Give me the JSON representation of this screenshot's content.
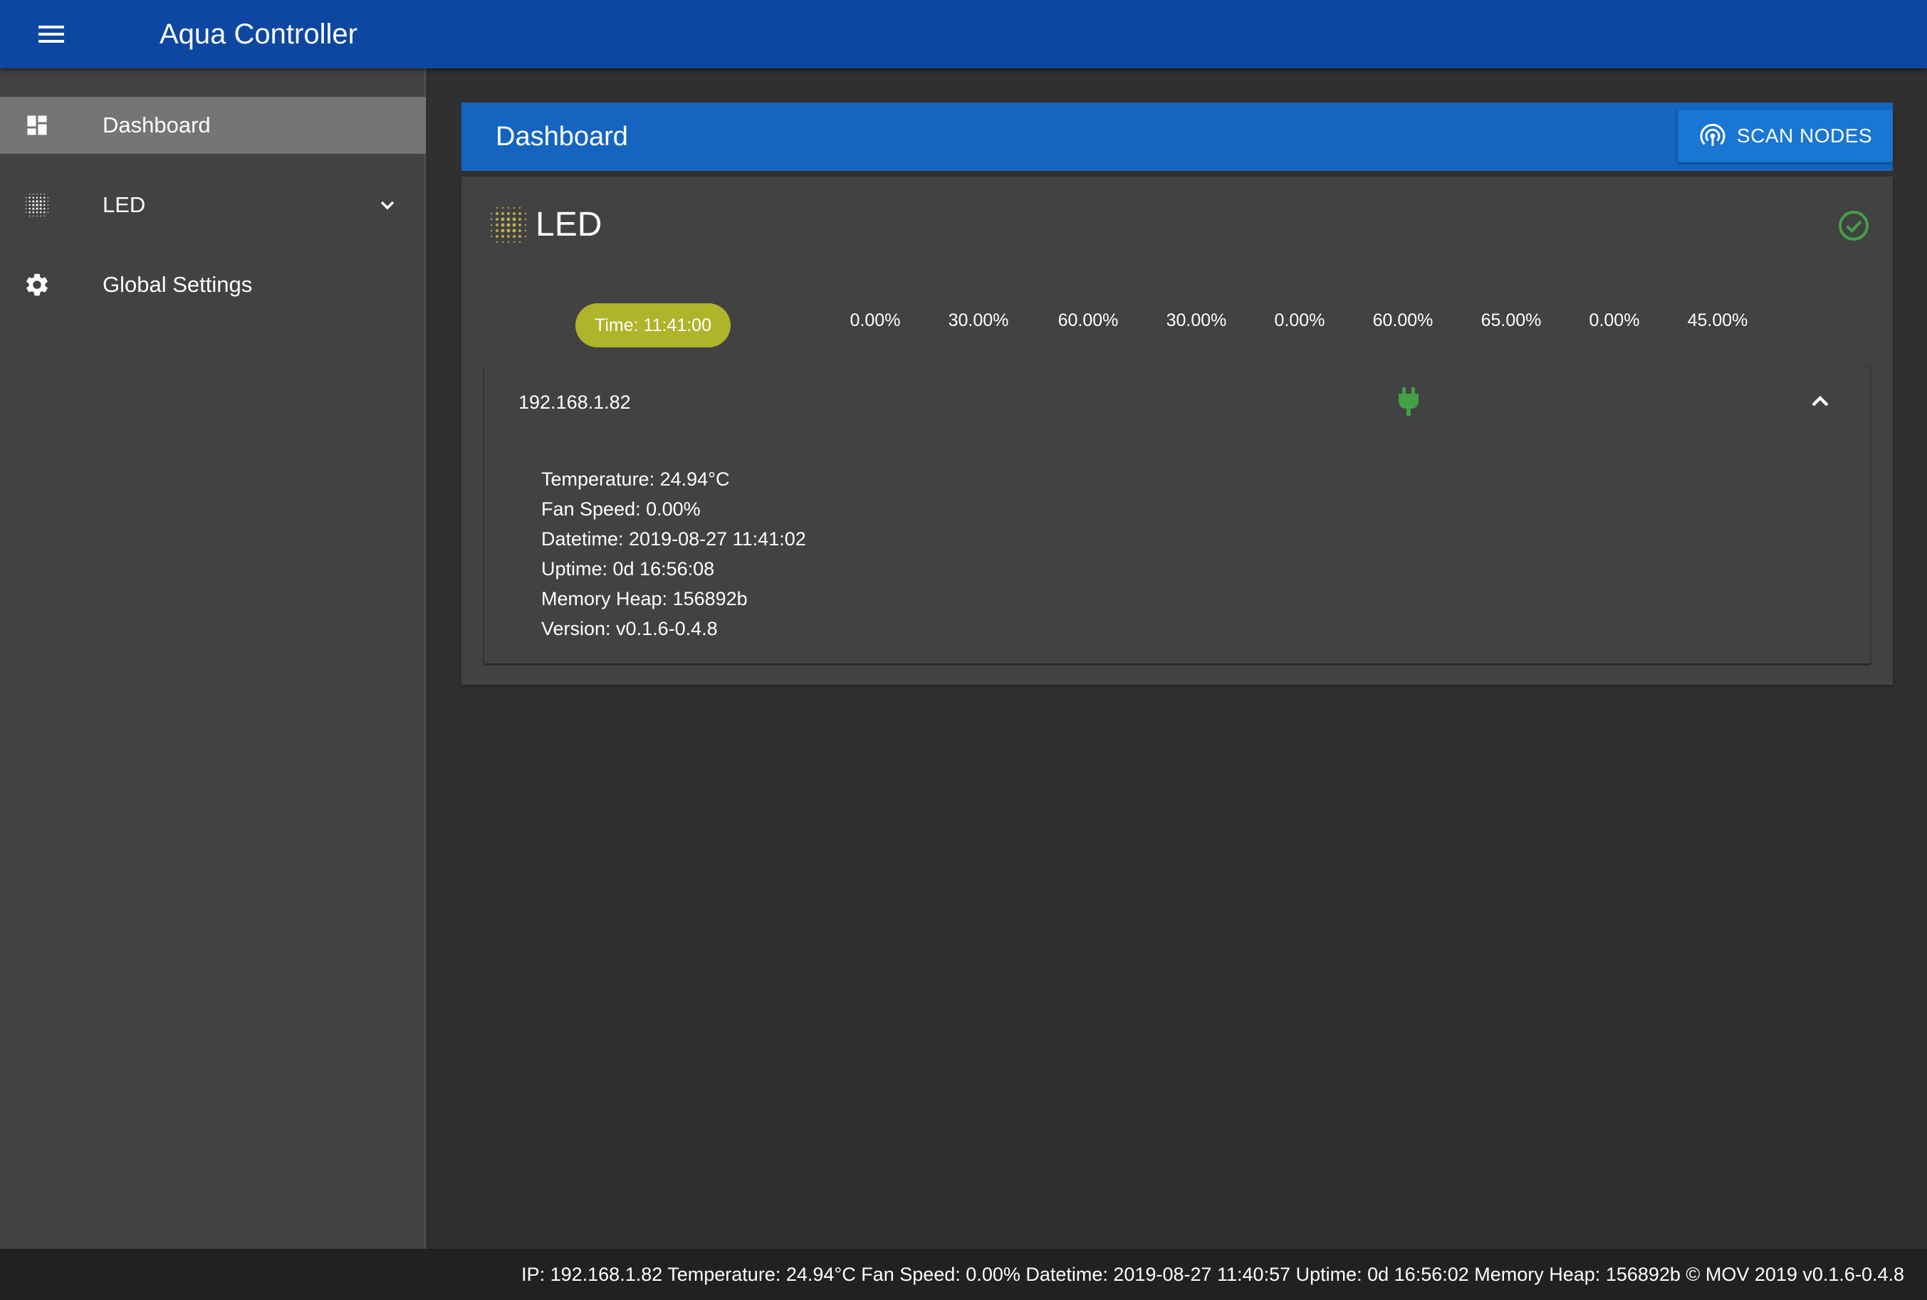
{
  "app": {
    "title": "Aqua Controller"
  },
  "sidebar": {
    "items": [
      {
        "label": "Dashboard",
        "icon": "dashboard-icon",
        "active": true
      },
      {
        "label": "LED",
        "icon": "led-grid-icon",
        "expandable": true
      },
      {
        "label": "Global Settings",
        "icon": "gear-icon"
      }
    ]
  },
  "dashboard": {
    "title": "Dashboard",
    "scan_button": {
      "label": "SCAN NODES",
      "icon": "broadcast-icon"
    }
  },
  "led_card": {
    "title": "LED",
    "icon": "led-grid-icon",
    "status_icon": "check-circle-icon",
    "status_color": "#43a047",
    "time": "Time: 11:41:00",
    "channels": [
      {
        "label": "0.00%",
        "color": "#4a148c",
        "text_color": "#ffffff"
      },
      {
        "label": "30.00%",
        "color": "#7b1fa2",
        "text_color": "#ffffff"
      },
      {
        "label": "60.00%",
        "color": "#3949ab",
        "text_color": "#ffffff"
      },
      {
        "label": "30.00%",
        "color": "#1e88e5",
        "text_color": "#ffffff"
      },
      {
        "label": "0.00%",
        "color": "#4dd0e1",
        "text_color": "#ffffff"
      },
      {
        "label": "60.00%",
        "color": "#2e7d32",
        "text_color": "#ffffff"
      },
      {
        "label": "65.00%",
        "color": "#d32f2f",
        "text_color": "#ffffff"
      },
      {
        "label": "0.00%",
        "color": "#ffeb3b",
        "text_color": "#ffffff"
      },
      {
        "label": "45.00%",
        "color": "#dddddd",
        "text_color": "#ffffff"
      }
    ],
    "node": {
      "ip": "192.168.1.82",
      "connection_icon": "plug-icon",
      "collapse_icon": "chevron-up-icon",
      "details": [
        "Temperature: 24.94°C",
        "Fan Speed: 0.00%",
        "Datetime: 2019-08-27 11:41:02",
        "Uptime: 0d 16:56:08",
        "Memory Heap: 156892b",
        "Version: v0.1.6-0.4.8"
      ]
    }
  },
  "footer": {
    "text": "IP: 192.168.1.82 Temperature: 24.94°C Fan Speed: 0.00% Datetime: 2019-08-27 11:40:57 Uptime: 0d 16:56:02 Memory Heap: 156892b © MOV 2019 v0.1.6-0.4.8"
  }
}
